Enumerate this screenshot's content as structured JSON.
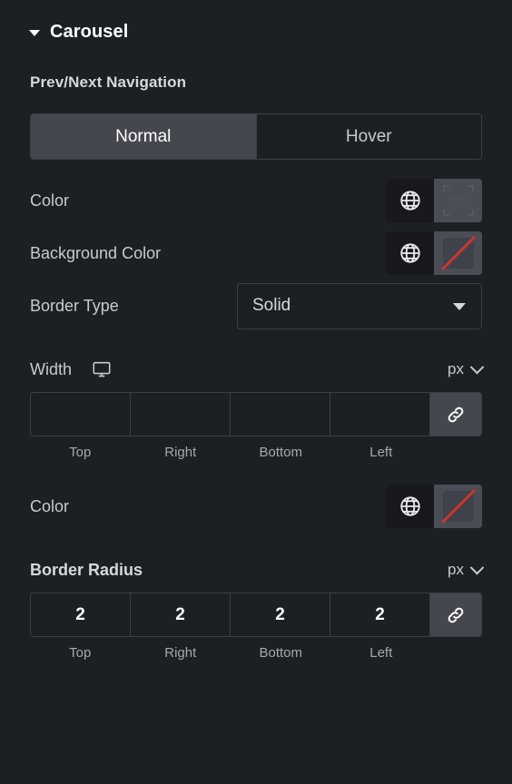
{
  "section": {
    "title": "Carousel",
    "collapse_icon": "chevron-down-icon"
  },
  "sub_heading": "Prev/Next Navigation",
  "tabs": [
    {
      "label": "Normal",
      "active": true
    },
    {
      "label": "Hover",
      "active": false
    }
  ],
  "controls": {
    "color": {
      "label": "Color",
      "globe_icon": "globe-icon",
      "swatch_state": "empty"
    },
    "background_color": {
      "label": "Background Color",
      "globe_icon": "globe-icon",
      "swatch_state": "none"
    },
    "border_type": {
      "label": "Border Type",
      "value": "Solid",
      "caret_icon": "chevron-down-icon"
    },
    "width": {
      "label": "Width",
      "device_icon": "desktop-icon",
      "unit": "px",
      "unit_caret_icon": "chevron-down-icon",
      "values": {
        "top": "",
        "right": "",
        "bottom": "",
        "left": ""
      },
      "placeholders": {
        "top": "",
        "right": "",
        "bottom": "",
        "left": ""
      },
      "side_labels": [
        "Top",
        "Right",
        "Bottom",
        "Left"
      ],
      "link_icon": "link-icon"
    },
    "border_color": {
      "label": "Color",
      "globe_icon": "globe-icon",
      "swatch_state": "none"
    },
    "border_radius": {
      "label": "Border Radius",
      "unit": "px",
      "unit_caret_icon": "chevron-down-icon",
      "values": {
        "top": "2",
        "right": "2",
        "bottom": "2",
        "left": "2"
      },
      "side_labels": [
        "Top",
        "Right",
        "Bottom",
        "Left"
      ],
      "link_icon": "link-icon"
    }
  },
  "colors": {
    "panel_background": "#1d2023",
    "active_tab": "#45474f",
    "border": "#3b3f46",
    "text_primary": "#ffffff",
    "text_secondary": "#c7cacf",
    "swatch_slash": "#d0342c"
  }
}
